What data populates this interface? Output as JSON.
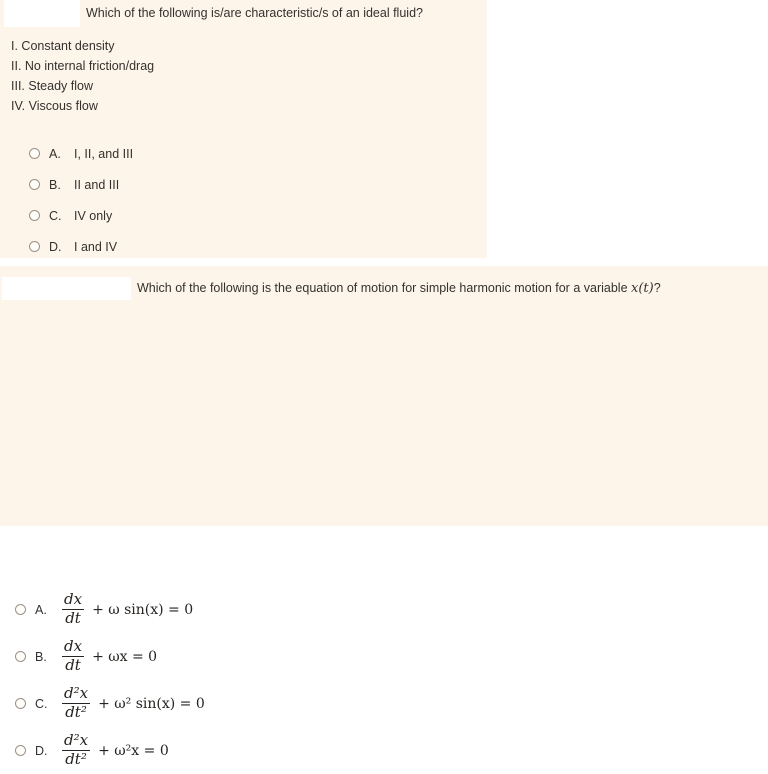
{
  "theme": {
    "panel_bg": "#fdf5ea",
    "page_bg": "#ffffff",
    "text": "#33312e",
    "blank_field_bg": "#ffffff",
    "radio_border": "#9b9287"
  },
  "questions": [
    {
      "id": "question-1",
      "prompt": "Which of the following is/are characteristic/s of an ideal fluid?",
      "blank_field_value": "",
      "statements": [
        "I. Constant density",
        "II. No internal friction/drag",
        "III. Steady flow",
        "IV. Viscous flow"
      ],
      "options": [
        {
          "letter": "A.",
          "text": "I, II, and III"
        },
        {
          "letter": "B.",
          "text": "II and III"
        },
        {
          "letter": "C.",
          "text": "IV only"
        },
        {
          "letter": "D.",
          "text": "I and IV"
        }
      ]
    },
    {
      "id": "question-2",
      "prompt_before_math": "Which of the following is the equation of motion for simple harmonic motion for a variable ",
      "prompt_math": "x(t)",
      "prompt_after_math": "?",
      "blank_field_value": "",
      "options": [
        {
          "letter": "A.",
          "numerator": "dx",
          "denominator": "dt",
          "remainder": "+ ω sin(x) = 0",
          "plain": "dx/dt + ω sin(x) = 0"
        },
        {
          "letter": "B.",
          "numerator": "dx",
          "denominator": "dt",
          "remainder": "+ ωx = 0",
          "plain": "dx/dt + ωx = 0"
        },
        {
          "letter": "C.",
          "numerator": "d²x",
          "denominator": "dt²",
          "remainder": "+ ω² sin(x) = 0",
          "plain": "d²x/dt² + ω² sin(x) = 0"
        },
        {
          "letter": "D.",
          "numerator": "d²x",
          "denominator": "dt²",
          "remainder": "+ ω²x = 0",
          "plain": "d²x/dt² + ω²x = 0"
        }
      ]
    }
  ]
}
